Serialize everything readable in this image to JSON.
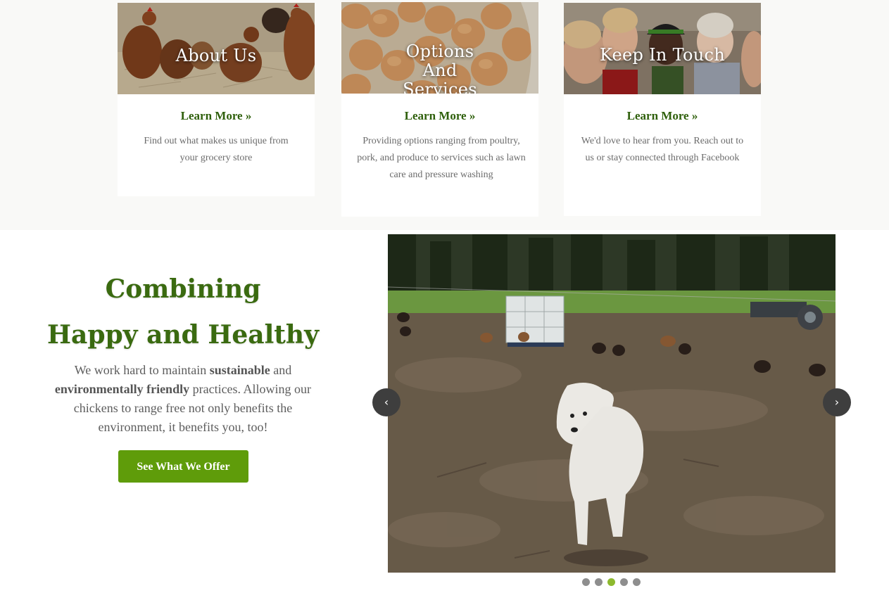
{
  "cards": [
    {
      "title": "About Us",
      "link": "Learn More »",
      "description": "Find out what makes us unique from your grocery store"
    },
    {
      "title": "Options And Services",
      "link": "Learn More »",
      "description": "Providing options ranging from poultry, pork, and produce to services such as lawn care and pressure washing"
    },
    {
      "title": "Keep In Touch",
      "link": "Learn More »",
      "description": "We'd love to hear from you. Reach out to us or stay connected through Facebook"
    }
  ],
  "feature": {
    "heading_line1": "Combining",
    "heading_line2": "Happy and Healthy",
    "intro_part1": "We work hard to maintain ",
    "intro_bold1": "sustainable",
    "intro_part2": " and ",
    "intro_bold2": "environmentally friendly",
    "intro_part3": " practices.  Allowing our chickens to range free not only benefits the environment, it benefits you, too!",
    "cta_label": "See What We Offer"
  },
  "slider": {
    "prev_icon": "chevron-left-icon",
    "next_icon": "chevron-right-icon",
    "prev_glyph": "‹",
    "next_glyph": "›",
    "slide_count": 5,
    "active_slide": 3
  },
  "colors": {
    "background_band": "#f9f9f7",
    "heading_green": "#3a6a10",
    "link_green": "#2e5f0b",
    "button_green": "#5f9c0a",
    "dot_active": "#8db92e",
    "dot_inactive": "#8e8e8e"
  }
}
